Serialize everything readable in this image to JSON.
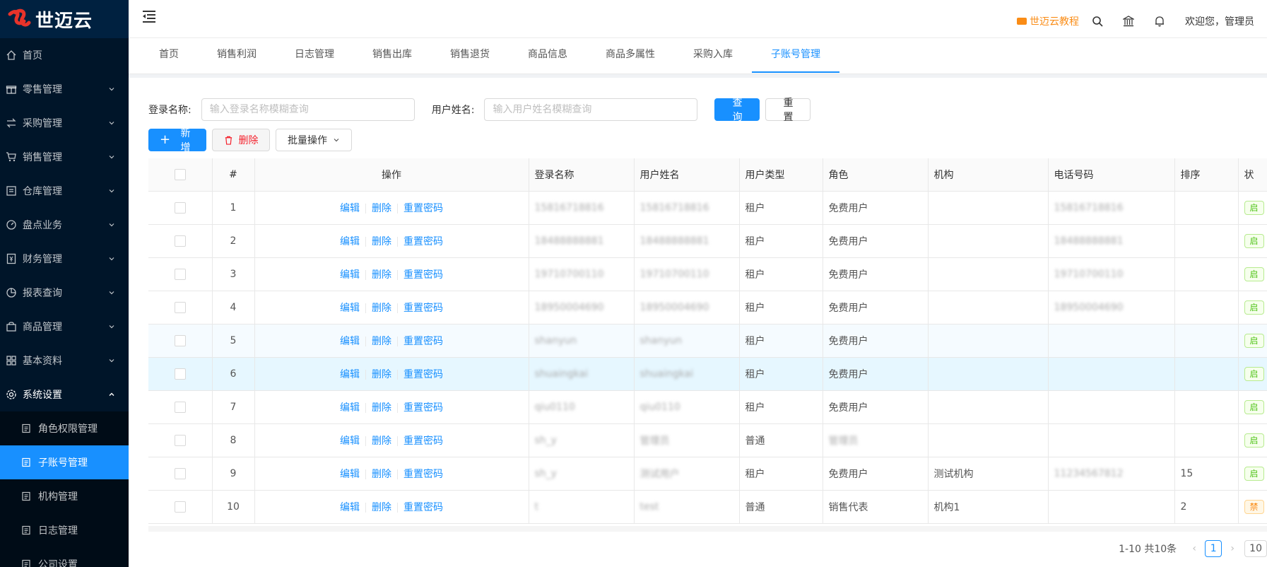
{
  "brand": {
    "name": "世迈云",
    "color": "#1890ff"
  },
  "sidebar": {
    "items": [
      {
        "label": "首页",
        "icon": "home-icon",
        "has_children": false
      },
      {
        "label": "零售管理",
        "icon": "gift-icon",
        "has_children": true
      },
      {
        "label": "采购管理",
        "icon": "swap-icon",
        "has_children": true
      },
      {
        "label": "销售管理",
        "icon": "cart-icon",
        "has_children": true
      },
      {
        "label": "仓库管理",
        "icon": "warehouse-icon",
        "has_children": true
      },
      {
        "label": "盘点业务",
        "icon": "dashboard-icon",
        "has_children": true
      },
      {
        "label": "财务管理",
        "icon": "account-book-icon",
        "has_children": true
      },
      {
        "label": "报表查询",
        "icon": "pie-chart-icon",
        "has_children": true
      },
      {
        "label": "商品管理",
        "icon": "shopping-icon",
        "has_children": true
      },
      {
        "label": "基本资料",
        "icon": "appstore-icon",
        "has_children": true
      },
      {
        "label": "系统设置",
        "icon": "setting-icon",
        "has_children": true,
        "open": true
      }
    ],
    "sub_items": [
      {
        "label": "角色权限管理",
        "active": false
      },
      {
        "label": "子账号管理",
        "active": true
      },
      {
        "label": "机构管理",
        "active": false
      },
      {
        "label": "日志管理",
        "active": false
      },
      {
        "label": "公司设置",
        "active": false
      }
    ]
  },
  "header": {
    "tutorial_label": "世迈云教程",
    "welcome": "欢迎您，管理员"
  },
  "tabs": [
    {
      "label": "首页",
      "active": false
    },
    {
      "label": "销售利润",
      "active": false
    },
    {
      "label": "日志管理",
      "active": false
    },
    {
      "label": "销售出库",
      "active": false
    },
    {
      "label": "销售退货",
      "active": false
    },
    {
      "label": "商品信息",
      "active": false
    },
    {
      "label": "商品多属性",
      "active": false
    },
    {
      "label": "采购入库",
      "active": false
    },
    {
      "label": "子账号管理",
      "active": true
    }
  ],
  "search": {
    "login_label": "登录名称:",
    "login_placeholder": "输入登录名称模糊查询",
    "user_label": "用户姓名:",
    "user_placeholder": "输入用户姓名模糊查询",
    "query_label": "查 询",
    "reset_label": "重 置"
  },
  "actions": {
    "add_label": "新增",
    "delete_label": "删除",
    "batch_label": "批量操作"
  },
  "table": {
    "columns": [
      "#",
      "操作",
      "登录名称",
      "用户姓名",
      "用户类型",
      "角色",
      "机构",
      "电话号码",
      "排序",
      "状"
    ],
    "op_labels": {
      "edit": "编辑",
      "delete": "删除",
      "reset_pwd": "重置密码"
    },
    "rows": [
      {
        "no": "1",
        "login": "15816718816",
        "name": "15816718816",
        "type": "租户",
        "role": "免费用户",
        "org": "",
        "phone": "15816718816",
        "sort": "",
        "status": "启",
        "status_kind": "ok"
      },
      {
        "no": "2",
        "login": "18488888881",
        "name": "18488888881",
        "type": "租户",
        "role": "免费用户",
        "org": "",
        "phone": "18488888881",
        "sort": "",
        "status": "启",
        "status_kind": "ok"
      },
      {
        "no": "3",
        "login": "19710700110",
        "name": "19710700110",
        "type": "租户",
        "role": "免费用户",
        "org": "",
        "phone": "19710700110",
        "sort": "",
        "status": "启",
        "status_kind": "ok"
      },
      {
        "no": "4",
        "login": "18950004690",
        "name": "18950004690",
        "type": "租户",
        "role": "免费用户",
        "org": "",
        "phone": "18950004690",
        "sort": "",
        "status": "启",
        "status_kind": "ok"
      },
      {
        "no": "5",
        "login": "shanyun",
        "name": "shanyun",
        "type": "租户",
        "role": "免费用户",
        "org": "",
        "phone": "",
        "sort": "",
        "status": "启",
        "status_kind": "ok"
      },
      {
        "no": "6",
        "login": "shuaingkai",
        "name": "shuaingkai",
        "type": "租户",
        "role": "免费用户",
        "org": "",
        "phone": "",
        "sort": "",
        "status": "启",
        "status_kind": "ok"
      },
      {
        "no": "7",
        "login": "qiu0110",
        "name": "qiu0110",
        "type": "租户",
        "role": "免费用户",
        "org": "",
        "phone": "",
        "sort": "",
        "status": "启",
        "status_kind": "ok"
      },
      {
        "no": "8",
        "login": "sh_y",
        "name": "管理员",
        "type": "普通",
        "role": "管理员",
        "org": "",
        "phone": "",
        "sort": "",
        "status": "启",
        "status_kind": "ok"
      },
      {
        "no": "9",
        "login": "sh_y",
        "name": "测试用户",
        "type": "租户",
        "role": "免费用户",
        "org": "测试机构",
        "phone": "11234567812",
        "sort": "15",
        "status": "启",
        "status_kind": "ok"
      },
      {
        "no": "10",
        "login": "t",
        "name": "test",
        "type": "普通",
        "role": "销售代表",
        "org": "机构1",
        "phone": "",
        "sort": "2",
        "status": "禁",
        "status_kind": "warn"
      }
    ]
  },
  "pagination": {
    "total_text": "1-10 共10条",
    "current_page": "1",
    "page_size": "10"
  }
}
